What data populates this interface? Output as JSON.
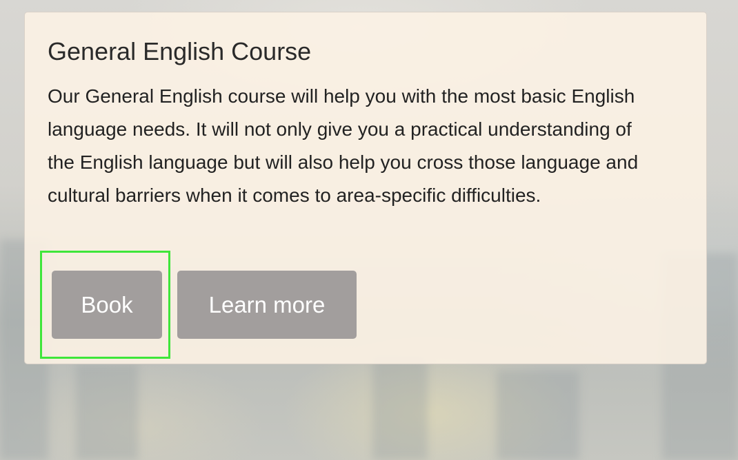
{
  "card": {
    "title": "General English Course",
    "description": "Our General English course will help you with the most basic English language needs. It will not only give you a practical understanding of the English language but will also help you cross those language and cultural barriers when it comes to area-specific difficulties.",
    "buttons": {
      "book_label": "Book",
      "learn_more_label": "Learn more"
    }
  },
  "colors": {
    "card_background": "#fcf2e4",
    "button_background": "#a29e9d",
    "button_text": "#ffffff",
    "highlight_border": "#3ee63a"
  }
}
